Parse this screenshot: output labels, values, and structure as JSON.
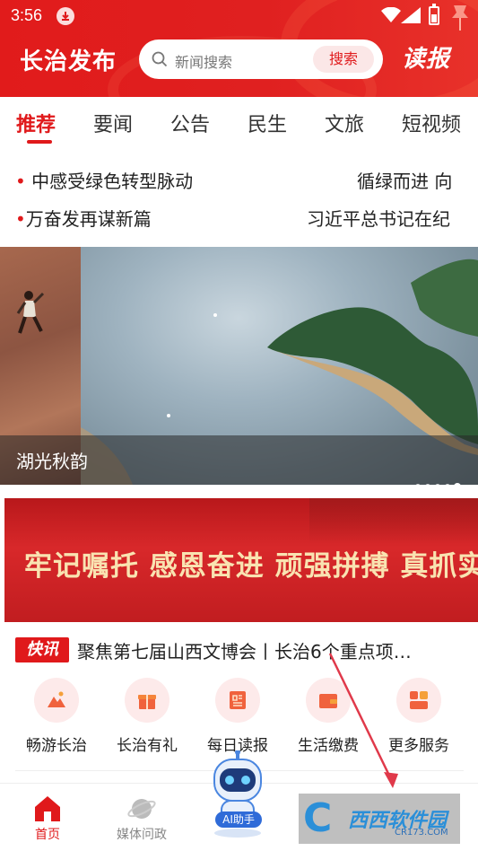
{
  "status_bar": {
    "time": "3:56"
  },
  "header": {
    "app_title": "长治发布",
    "search_placeholder": "新闻搜索",
    "search_button": "搜索",
    "read_paper": "读报"
  },
  "tabs": [
    {
      "label": "推荐",
      "active": true
    },
    {
      "label": "要闻",
      "active": false
    },
    {
      "label": "公告",
      "active": false
    },
    {
      "label": "民生",
      "active": false
    },
    {
      "label": "文旅",
      "active": false
    },
    {
      "label": "短视频",
      "active": false
    }
  ],
  "ticker": {
    "left_1": "中感受绿色转型脉动",
    "right_1": "循绿而进 向",
    "left_2": "万奋发再谋新篇",
    "right_2": "习近平总书记在纪"
  },
  "carousel": {
    "caption": "湖光秋韵",
    "dot_count": 5,
    "active_dot": 5
  },
  "banner": {
    "text": "牢记嘱托 感恩奋进 顽强拼搏 真抓实干",
    "dot_count": 3
  },
  "flash": {
    "tag": "快讯",
    "text": "聚焦第七届山西文博会丨长治6个重点项…"
  },
  "services": [
    {
      "label": "畅游长治",
      "icon": "mountain-icon"
    },
    {
      "label": "长治有礼",
      "icon": "gift-icon"
    },
    {
      "label": "每日读报",
      "icon": "newspaper-icon"
    },
    {
      "label": "生活缴费",
      "icon": "wallet-icon"
    },
    {
      "label": "更多服务",
      "icon": "grid-icon"
    }
  ],
  "bottom_nav": {
    "home": "首页",
    "media": "媒体问政",
    "ai": "AI助手"
  },
  "watermark": {
    "brand": "西西软件园",
    "domain": "CR173.COM"
  },
  "colors": {
    "accent": "#e0191b",
    "flash_bg": "#e0191b",
    "banner_text": "#f9e3b1"
  }
}
